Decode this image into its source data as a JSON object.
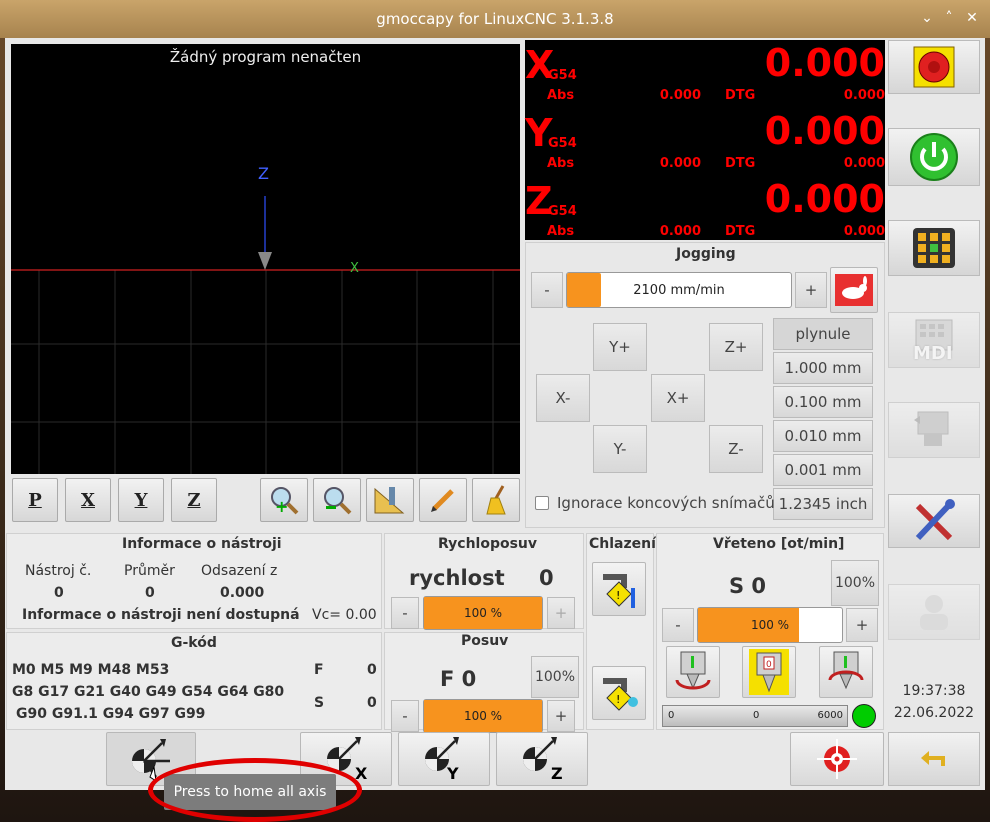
{
  "window": {
    "title": "gmoccapy for LinuxCNC  3.1.3.8"
  },
  "preview": {
    "no_program": "Žádný program nenačten",
    "z_axis_label": "Z",
    "x_axis_label": "X"
  },
  "view_buttons": {
    "p": "P",
    "x": "X",
    "y": "Y",
    "z": "Z"
  },
  "dro": {
    "axes": [
      {
        "axis": "X",
        "coord": "G54",
        "value": "0.000",
        "abs_label": "Abs",
        "abs_value": "0.000",
        "dtg_label": "DTG",
        "dtg_value": "0.000"
      },
      {
        "axis": "Y",
        "coord": "G54",
        "value": "0.000",
        "abs_label": "Abs",
        "abs_value": "0.000",
        "dtg_label": "DTG",
        "dtg_value": "0.000"
      },
      {
        "axis": "Z",
        "coord": "G54",
        "value": "0.000",
        "abs_label": "Abs",
        "abs_value": "0.000",
        "dtg_label": "DTG",
        "dtg_value": "0.000"
      }
    ]
  },
  "jogging": {
    "title": "Jogging",
    "minus": "-",
    "plus": "+",
    "speed": "2100 mm/min",
    "speed_fraction": 0.15,
    "buttons": {
      "y_plus": "Y+",
      "y_minus": "Y-",
      "x_minus": "X-",
      "x_plus": "X+",
      "z_plus": "Z+",
      "z_minus": "Z-"
    },
    "increments": [
      "plynule",
      "1.000 mm",
      "0.100 mm",
      "0.010 mm",
      "0.001 mm",
      "1.2345 inch"
    ],
    "ignore_limits": "Ignorace koncových snímačů"
  },
  "tool_info": {
    "title": "Informace o nástroji",
    "headers": [
      "Nástroj č.",
      "Průměr",
      "Odsazení z"
    ],
    "values": [
      "0",
      "0",
      "0.000"
    ],
    "message": "Informace o nástroji není dostupná",
    "vc": "Vc= 0.00"
  },
  "gcode": {
    "title": "G-kód",
    "line1": "M0 M5 M9 M48 M53",
    "line2": "G8 G17 G21 G40 G49 G54 G64 G80",
    "line3": "G90 G91.1 G94 G97 G99",
    "f_label": "F",
    "f_value": "0",
    "s_label": "S",
    "s_value": "0"
  },
  "rapid": {
    "title": "Rychloposuv",
    "label": "rychlost",
    "value": "0",
    "percent": "100 %",
    "fraction": 1.0,
    "minus": "-",
    "plus": "+"
  },
  "feed": {
    "title": "Posuv",
    "label": "F  0",
    "percent_button": "100%",
    "percent": "100 %",
    "fraction": 1.0,
    "minus": "-",
    "plus": "+"
  },
  "coolant": {
    "title": "Chlazení"
  },
  "spindle": {
    "title": "Vřeteno [ot/min]",
    "label": "S 0",
    "percent_button": "100%",
    "percent": "100 %",
    "fraction": 0.7,
    "minus": "-",
    "plus": "+",
    "bar_min": "0",
    "bar_value": "0",
    "bar_max": "6000"
  },
  "clock": {
    "time": "19:37:38",
    "date": "22.06.2022"
  },
  "sidebar": {
    "mdi_label": "MDI"
  },
  "tooltip": {
    "text": "Press to home all axis"
  },
  "colors": {
    "dro_red": "#ff0000",
    "orange": "#f7931e",
    "led_green": "#00cc00"
  }
}
